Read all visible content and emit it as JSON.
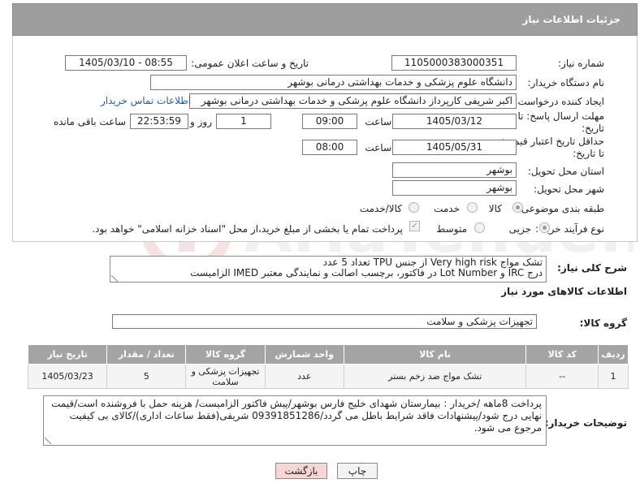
{
  "header": {
    "title": "جزئیات اطلاعات نیاز"
  },
  "form": {
    "need_number_label": "شماره نیاز:",
    "need_number_value": "1105000383000351",
    "announce_label": "تاریخ و ساعت اعلان عمومی:",
    "announce_value": "1405/03/10 - 08:55",
    "buyer_org_label": "نام دستگاه خریدار:",
    "buyer_org_value": "دانشگاه علوم پزشکی و خدمات بهداشتی درمانی بوشهر",
    "requester_label": "ایجاد کننده درخواست:",
    "requester_value": "اکبر شریفی کارپرداز دانشگاه علوم پزشکی و خدمات بهداشتی درمانی بوشهر",
    "contact_link": "اطلاعات تماس خریدار",
    "deadline_label_1": "مهلت ارسال پاسخ: تا",
    "deadline_label_2": "تاریخ:",
    "deadline_date": "1405/03/12",
    "time_label": "ساعت",
    "deadline_time": "09:00",
    "days_value": "1",
    "days_label": "روز و",
    "remaining_value": "22:53:59",
    "remaining_label": "ساعت باقی مانده",
    "price_validity_label_1": "حداقل تاریخ اعتبار قیمت:",
    "price_validity_label_2": "تا تاریخ:",
    "price_validity_date": "1405/05/31",
    "price_validity_time": "08:00",
    "delivery_province_label": "استان محل تحویل:",
    "delivery_province_value": "بوشهر",
    "delivery_city_label": "شهر محل تحویل:",
    "delivery_city_value": "بوشهر",
    "category_label": "طبقه بندی موضوعی:",
    "category_options": [
      "کالا",
      "خدمت",
      "کالا/خدمت"
    ],
    "process_label": "نوع فرآیند خرید :",
    "process_options": [
      "جزیی",
      "متوسط"
    ],
    "payment_note": "پرداخت تمام یا بخشی از مبلغ خرید،از محل \"اسناد خزانه اسلامی\" خواهد بود."
  },
  "description": {
    "label": "شرح کلی نیاز:",
    "line1": "تشک مواج Very high risk از جنس TPU تعداد 5 عدد",
    "line2": "درج IRC و Lot Number در فاکتور، برچسب اصالت و نمایندگی معتبر IMED الزامیست"
  },
  "goods_info": {
    "title": "اطلاعات کالاهای مورد نیاز",
    "group_label": "گروه کالا:",
    "group_value": "تجهیزات پزشکی و سلامت"
  },
  "table": {
    "headers": [
      "ردیف",
      "کد کالا",
      "نام کالا",
      "واحد شمارش",
      "گروه کالا",
      "تعداد / مقدار",
      "تاریخ نیاز"
    ],
    "rows": [
      [
        "1",
        "--",
        "تشک مواج ضد زخم بستر",
        "عدد",
        "تجهیزات پزشکی و سلامت",
        "5",
        "1405/03/23"
      ]
    ]
  },
  "buyer_notes": {
    "label": "توضیحات خریدار:",
    "text": "پرداخت 8ماهه /خریدار : بیمارستان شهدای خلیج فارس بوشهر/پیش فاکتور الزامیست/ هزینه حمل با فروشنده است/قیمت نهایی درج شود/پیشنهادات فاقد شرایط باطل می گردد/09391851286 شریفی(فقط ساعات اداری)/کالای بی کیفیت مرجوع می شود."
  },
  "buttons": {
    "print": "چاپ",
    "back": "بازگشت"
  },
  "colors": {
    "header_bg": "#9e9e9e",
    "table_header_bg": "#a4a4a4",
    "link": "#1a5fb4",
    "back_bg": "#f7d6d6"
  }
}
